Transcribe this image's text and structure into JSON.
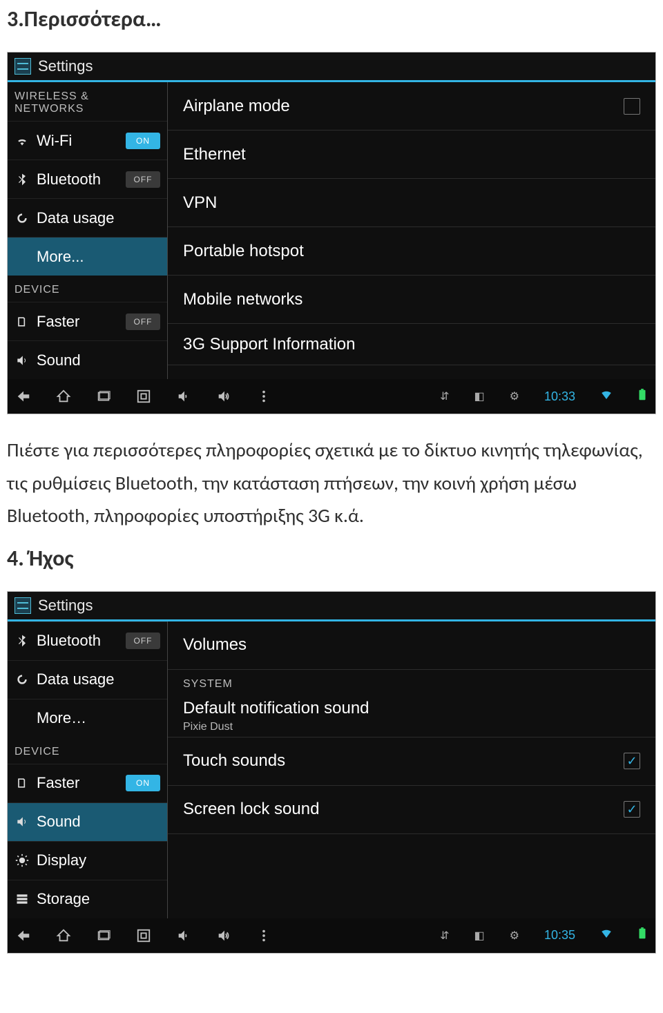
{
  "headings": {
    "more": "3.Περισσότερα…",
    "sound": "4. Ήχος"
  },
  "paragraph": "Πιέστε για περισσότερες πληροφορίες σχετικά με το δίκτυο κινητής τηλεφωνίας, τις ρυθμίσεις Bluetooth, την κατάσταση πτήσεων, την κοινή χρήση μέσω Bluetooth, πληροφορίες υποστήριξης 3G κ.ά.",
  "shot1": {
    "title": "Settings",
    "section_wireless": "WIRELESS & NETWORKS",
    "section_device": "DEVICE",
    "sidebar": {
      "wifi": {
        "label": "Wi-Fi",
        "toggle": "ON"
      },
      "bt": {
        "label": "Bluetooth",
        "toggle": "OFF"
      },
      "data": {
        "label": "Data usage"
      },
      "more": {
        "label": "More..."
      },
      "faster": {
        "label": "Faster",
        "toggle": "OFF"
      },
      "sound": {
        "label": "Sound"
      }
    },
    "content": {
      "airplane": "Airplane mode",
      "ethernet": "Ethernet",
      "vpn": "VPN",
      "hotspot": "Portable hotspot",
      "mobile": "Mobile networks",
      "support3g": "3G Support Information"
    },
    "clock": "10:33"
  },
  "shot2": {
    "title": "Settings",
    "section_system": "SYSTEM",
    "section_device": "DEVICE",
    "sidebar": {
      "bt": {
        "label": "Bluetooth",
        "toggle": "OFF"
      },
      "data": {
        "label": "Data usage"
      },
      "more": {
        "label": "More…"
      },
      "faster": {
        "label": "Faster",
        "toggle": "ON"
      },
      "sound": {
        "label": "Sound"
      },
      "display": {
        "label": "Display"
      },
      "storage": {
        "label": "Storage"
      }
    },
    "content": {
      "volumes": "Volumes",
      "notif": {
        "label": "Default notification sound",
        "sub": "Pixie Dust"
      },
      "touch": "Touch sounds",
      "screenlock": "Screen lock sound"
    },
    "clock": "10:35"
  }
}
